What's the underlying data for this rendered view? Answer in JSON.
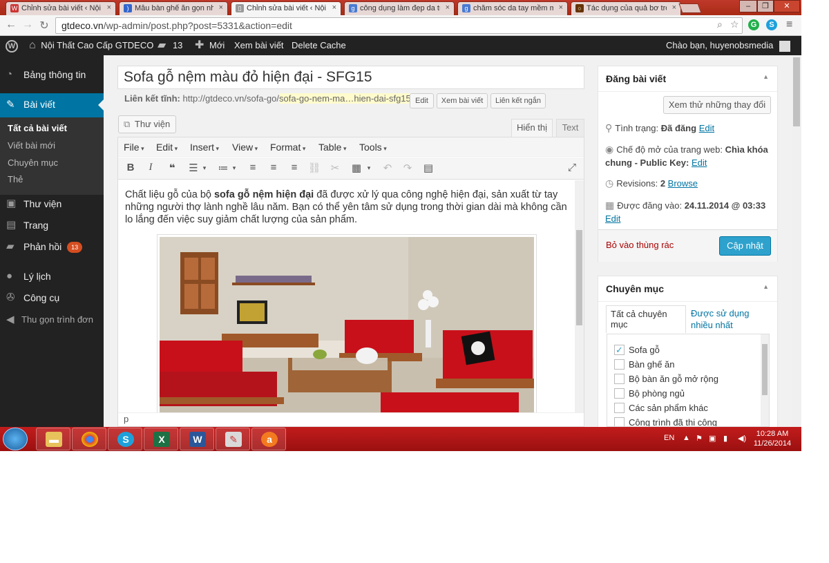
{
  "browser": {
    "tabs": [
      {
        "title": "Chỉnh sửa bài viết ‹ Nội Th",
        "icon_color": "#cc3333",
        "active": false
      },
      {
        "title": "Mẫu bàn ghế ăn gọn nhẹ",
        "icon_color": "#3366cc",
        "active": false
      },
      {
        "title": "Chỉnh sửa bài viết ‹ Nội Th",
        "icon_color": "#cc3333",
        "active": true
      },
      {
        "title": "công dụng làm đẹp da từ",
        "icon_color": "#4a7bd4",
        "active": false
      },
      {
        "title": "chăm sóc da tay mềm ma",
        "icon_color": "#4a7bd4",
        "active": false
      },
      {
        "title": "Tác dụng của quả bơ tron",
        "icon_color": "#663300",
        "active": false
      }
    ],
    "close_glyph": "×",
    "url_domain": "gtdeco.vn",
    "url_path": "/wp-admin/post.php?post=5331&action=edit"
  },
  "adminbar": {
    "site_name": "Nội Thất Cao Cấp GTDECO",
    "comments_count": "13",
    "new_label": "Mới",
    "view_post": "Xem bài viết",
    "delete_cache": "Delete Cache",
    "greeting": "Chào bạn, huyenobsmedia"
  },
  "sidebar": {
    "dashboard": "Bảng thông tin",
    "posts": "Bài viết",
    "sub": [
      "Tất cả bài viết",
      "Viết bài mới",
      "Chuyên mục",
      "Thẻ"
    ],
    "media": "Thư viện",
    "pages": "Trang",
    "comments": "Phản hồi",
    "comments_badge": "13",
    "profile": "Lý lịch",
    "tools": "Công cụ",
    "collapse": "Thu gọn trình đơn"
  },
  "editor": {
    "title": "Sofa gỗ nệm màu đỏ hiện đại - SFG15",
    "permalink_label": "Liên kết tĩnh:",
    "permalink_base": "http://gtdeco.vn/sofa-go/",
    "permalink_slug": "sofa-go-nem-ma…hien-dai-sfg15",
    "permalink_end": "/",
    "edit_btn": "Edit",
    "view_btn": "Xem bài viết",
    "shortlink_btn": "Liên kết ngắn",
    "media_btn": "Thư viện",
    "tab_visual": "Hiển thị",
    "tab_text": "Text",
    "menus": [
      "File",
      "Edit",
      "Insert",
      "View",
      "Format",
      "Table",
      "Tools"
    ],
    "para_before": "Chất liệu gỗ của bộ ",
    "para_bold": "sofa gỗ nệm hiện đại",
    "para_after": " đã được xử lý qua công nghệ hiện đại, sản xuất từ tay những người thợ lành nghề lâu năm. Bạn có thể yên tâm sử dụng trong thời gian dài mà không cần lo lắng đến việc suy giảm chất lượng của sản phẩm.",
    "status_path": "p"
  },
  "publish": {
    "title": "Đăng bài viết",
    "preview_btn": "Xem thử những thay đổi",
    "status_label": "Tình trạng:",
    "status_value": "Đã đăng",
    "visibility_label": "Chế độ mở của trang web:",
    "visibility_value": "Chìa khóa chung - Public Key:",
    "revisions_label": "Revisions:",
    "revisions_value": "2",
    "browse": "Browse",
    "published_label": "Được đăng vào:",
    "published_value": "24.11.2014 @ 03:33",
    "edit": "Edit",
    "trash": "Bỏ vào thùng rác",
    "update_btn": "Cập nhật"
  },
  "categories": {
    "title": "Chuyên mục",
    "tab_all": "Tất cả chuyên mục",
    "tab_popular": "Được sử dụng nhiều nhất",
    "items": [
      {
        "label": "Sofa gỗ",
        "checked": true
      },
      {
        "label": "Bàn ghế ăn",
        "checked": false
      },
      {
        "label": "Bộ bàn ăn gỗ mở rộng",
        "checked": false
      },
      {
        "label": "Bộ phòng ngủ",
        "checked": false
      },
      {
        "label": "Các sản phẩm khác",
        "checked": false
      },
      {
        "label": "Công trình đã thi công",
        "checked": false
      }
    ]
  },
  "taskbar": {
    "lang": "EN",
    "time": "10:28 AM",
    "date": "11/26/2014"
  },
  "colors": {
    "admin_bar": "#222222",
    "accent": "#0074a2",
    "primary_button": "#2ea2cc",
    "taskbar": "#b01414"
  }
}
